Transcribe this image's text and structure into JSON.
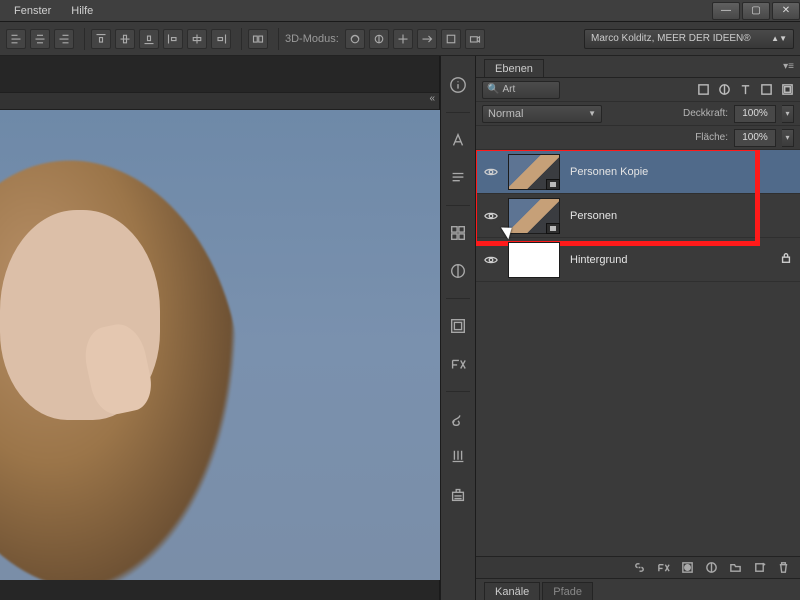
{
  "menubar": {
    "window": "Fenster",
    "help": "Hilfe"
  },
  "optbar": {
    "mode3d_label": "3D-Modus:",
    "credit": "Marco Kolditz, MEER DER IDEEN®"
  },
  "panel": {
    "tab": "Ebenen",
    "search_placeholder": "Art",
    "blend_mode": "Normal",
    "opacity_label": "Deckkraft:",
    "opacity_value": "100%",
    "fill_label": "Fläche:",
    "fill_value": "100%"
  },
  "layers": [
    {
      "name": "Personen Kopie",
      "visible": true,
      "selected": true,
      "smart": true,
      "thumb": "photo"
    },
    {
      "name": "Personen",
      "visible": true,
      "selected": false,
      "smart": true,
      "thumb": "photo"
    },
    {
      "name": "Hintergrund",
      "visible": true,
      "selected": false,
      "locked": true,
      "thumb": "white"
    }
  ],
  "channels": {
    "tab1": "Kanäle",
    "tab2": "Pfade"
  }
}
